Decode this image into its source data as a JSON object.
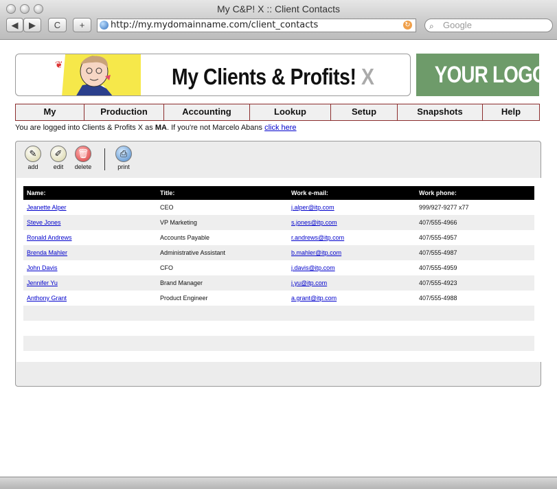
{
  "window": {
    "title": "My C&P! X :: Client Contacts"
  },
  "browser": {
    "back_label": "◀",
    "forward_label": "▶",
    "reload_label": "C",
    "add_label": "+",
    "url": "http://my.mydomainname.com/client_contacts",
    "search_placeholder": "Google"
  },
  "banner": {
    "title_main": "My Clients & Profits!",
    "title_suffix": "X",
    "logo_text": "YOUR LOGO HERE"
  },
  "menu": [
    "My",
    "Production",
    "Accounting",
    "Lookup",
    "Setup",
    "Snapshots",
    "Help"
  ],
  "login": {
    "prefix": "You are logged into Clients & Profits X as",
    "user": "MA",
    "middle": ". If you're not Marcelo Abans",
    "link": "click here"
  },
  "toolbar": {
    "add": "add",
    "edit": "edit",
    "delete": "delete",
    "print": "print"
  },
  "table": {
    "headers": [
      "Name:",
      "Title:",
      "Work e-mail:",
      "Work phone:"
    ],
    "rows": [
      [
        "Jeanette Alper",
        "CEO",
        "j.alper@itp.com",
        "999/927-9277 x77"
      ],
      [
        "Steve Jones",
        "VP Marketing",
        "s.jones@itp.com",
        "407/555-4966"
      ],
      [
        "Ronald Andrews",
        "Accounts Payable",
        "r.andrews@itp.com",
        "407/555-4957"
      ],
      [
        "Brenda Mahler",
        "Administrative Assistant",
        "b.mahler@itp.com",
        "407/555-4987"
      ],
      [
        "John Davis",
        "CFO",
        "j.davis@itp.com",
        "407/555-4959"
      ],
      [
        "Jennifer Yu",
        "Brand Manager",
        "j.yu@itp.com",
        "407/555-4923"
      ],
      [
        "Anthony Grant",
        "Product Engineer",
        "a.grant@itp.com",
        "407/555-4988"
      ]
    ]
  }
}
